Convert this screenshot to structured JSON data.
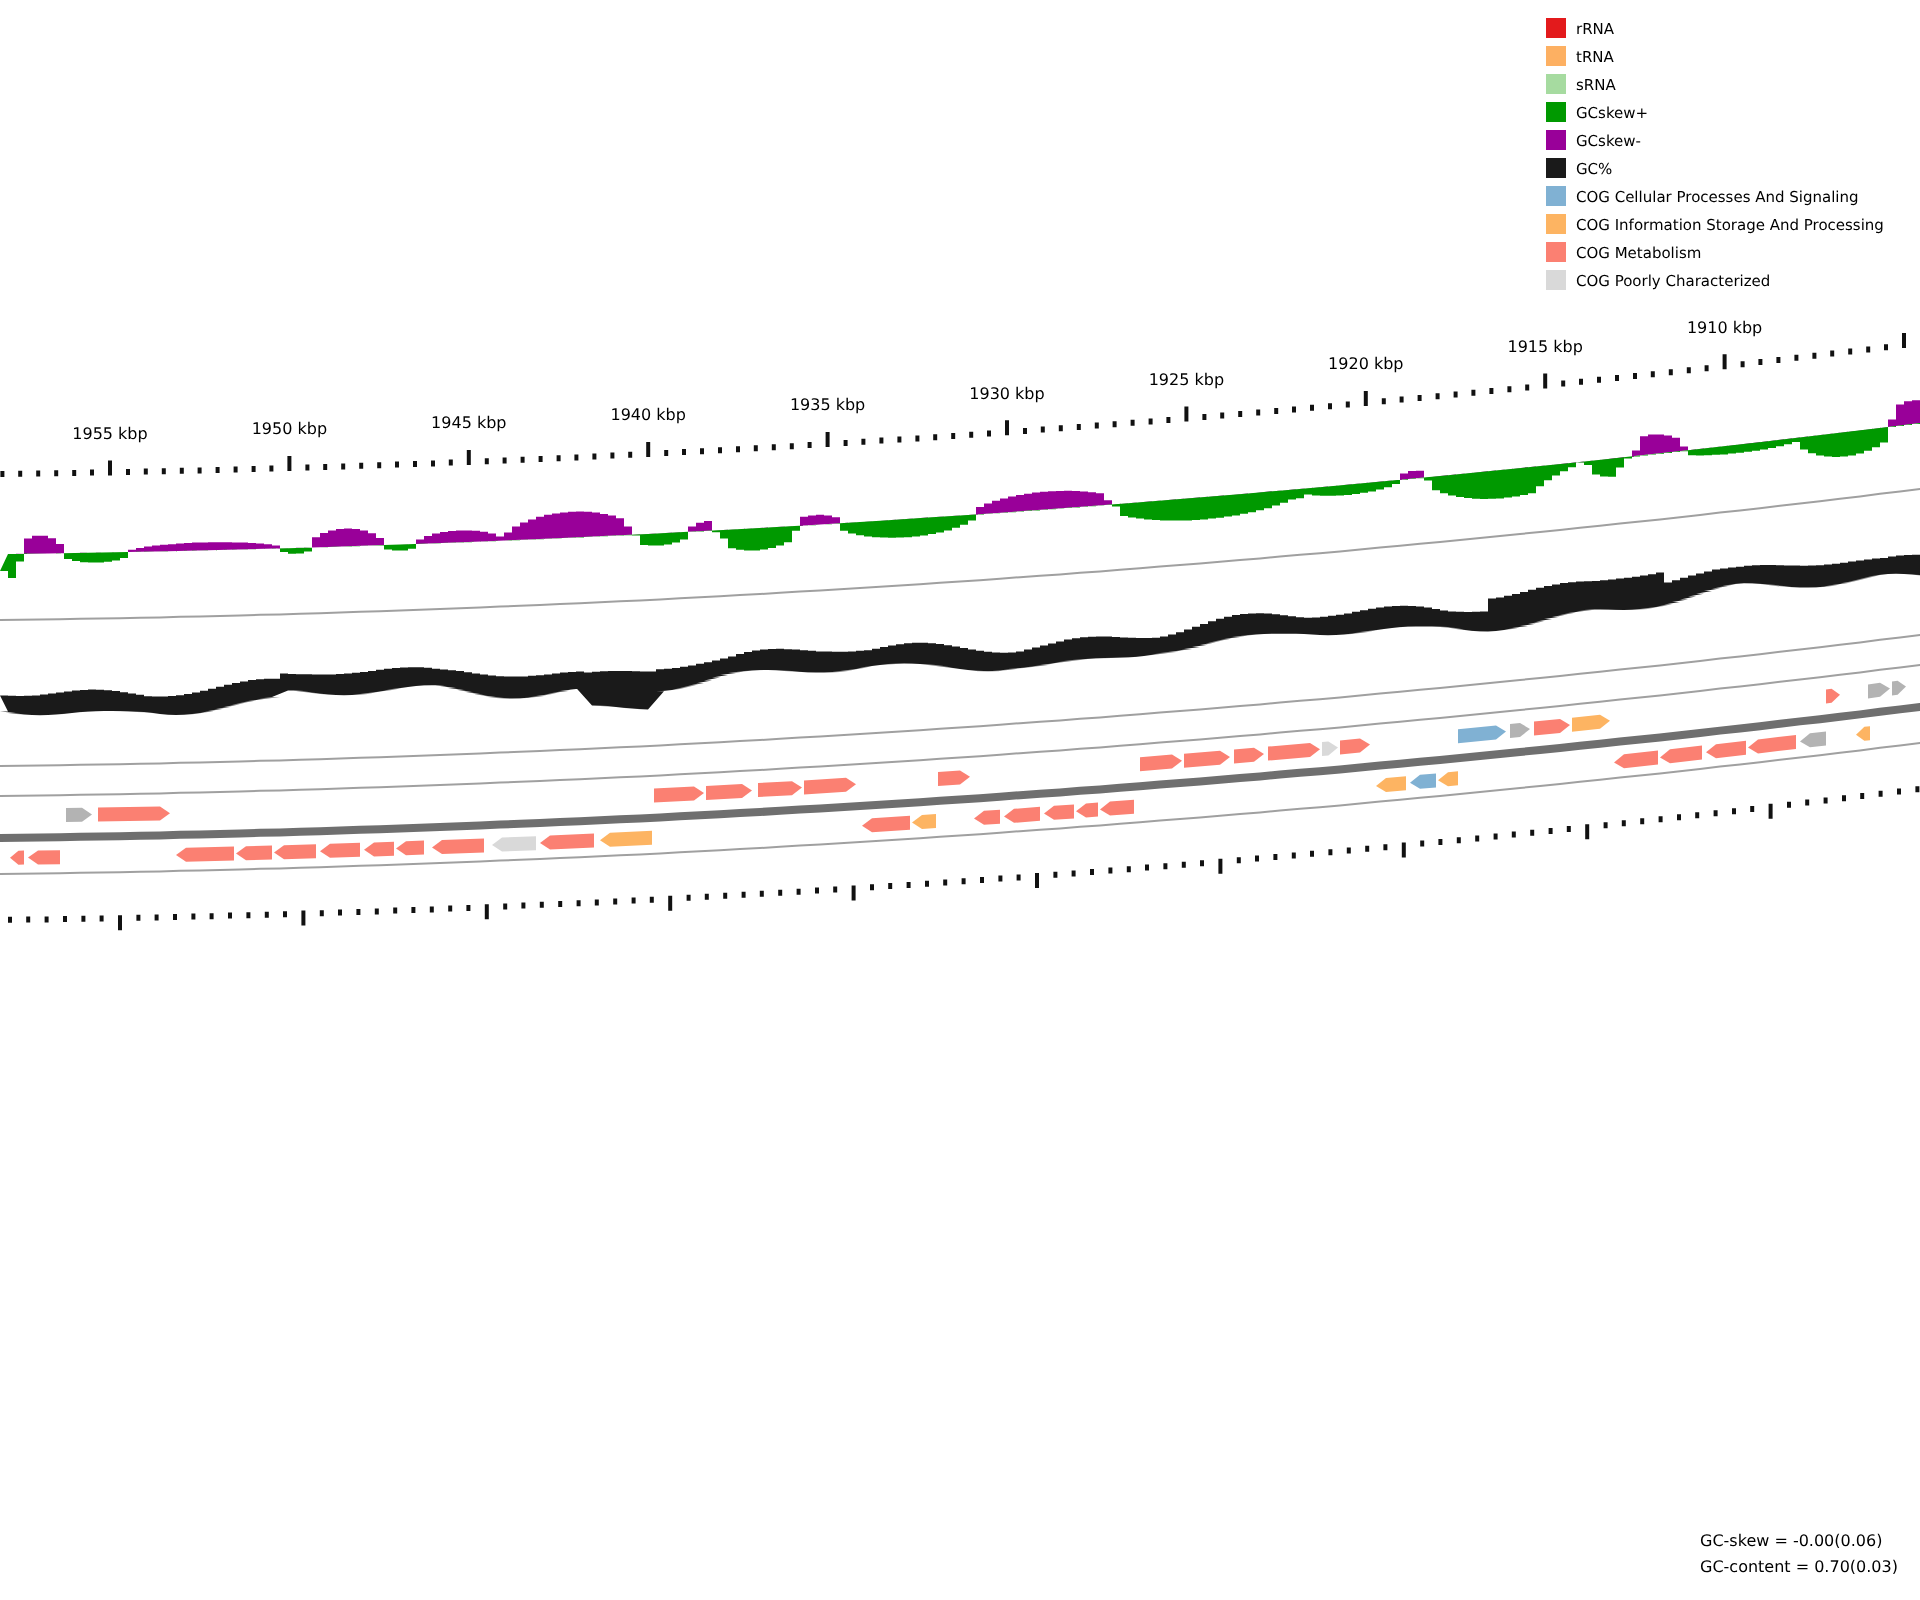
{
  "legend": [
    {
      "label": "rRNA",
      "color": "#e31a1c"
    },
    {
      "label": "tRNA",
      "color": "#fdb062"
    },
    {
      "label": "sRNA",
      "color": "#a6dba0"
    },
    {
      "label": "GCskew+",
      "color": "#009900"
    },
    {
      "label": "GCskew-",
      "color": "#990099"
    },
    {
      "label": "GC%",
      "color": "#1a1a1a"
    },
    {
      "label": "COG Cellular Processes And Signaling",
      "color": "#80b1d3"
    },
    {
      "label": "COG Information Storage And Processing",
      "color": "#fdb462"
    },
    {
      "label": "COG Metabolism",
      "color": "#fb8072"
    },
    {
      "label": "COG Poorly Characterized",
      "color": "#d9d9d9"
    }
  ],
  "tick_labels": [
    "1955 kbp",
    "1950 kbp",
    "1945 kbp",
    "1940 kbp",
    "1935 kbp",
    "1930 kbp",
    "1925 kbp",
    "1920 kbp",
    "1915 kbp",
    "1910 kbp"
  ],
  "stats": [
    "GC-skew = -0.00(0.06)",
    "GC-content = 0.70(0.03)"
  ]
}
